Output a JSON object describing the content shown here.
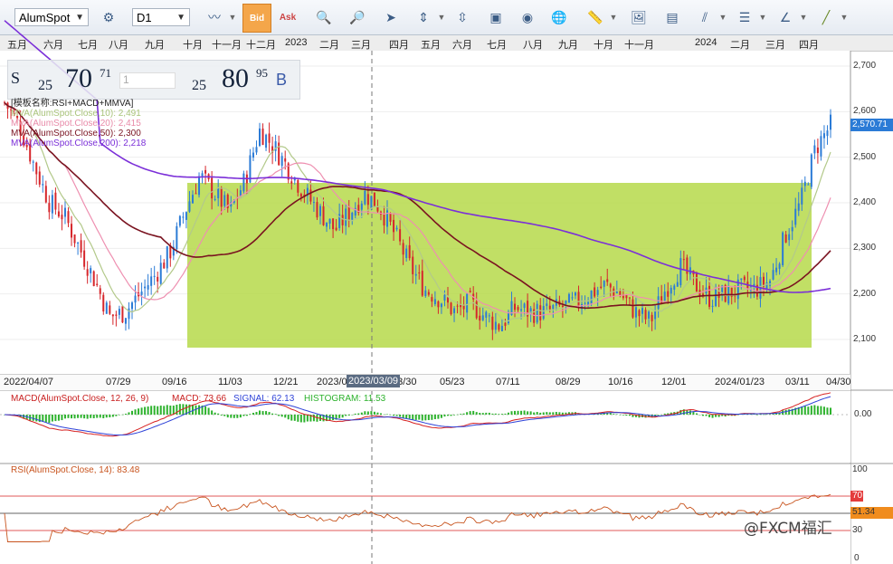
{
  "toolbar": {
    "symbol": "AlumSpot",
    "timeframe": "D1",
    "bid_label": "Bid",
    "ask_label": "Ask"
  },
  "months_top": [
    "五月",
    "六月",
    "七月",
    "八月",
    "九月",
    "十月",
    "十一月",
    "十二月",
    "2023",
    "二月",
    "三月",
    "四月",
    "五月",
    "六月",
    "七月",
    "八月",
    "九月",
    "十月",
    "十一月",
    "2024",
    "二月",
    "三月",
    "四月"
  ],
  "quote": {
    "sell_letter": "S",
    "sell_prefix": "25",
    "sell_big": "70",
    "sell_sup": "71",
    "lot": "1",
    "buy_prefix": "25",
    "buy_big": "80",
    "buy_sup": "95",
    "buy_letter": "B"
  },
  "legend": {
    "template": "[模板名称:RSI+MACD+MMVA]",
    "mva10": "MVA(AlumSpot.Close,10): 2,491",
    "mva20": "MVA(AlumSpot.Close,20): 2,415",
    "mva50": "MVA(AlumSpot.Close,50): 2,300",
    "mva200": "MVA(AlumSpot.Close,200): 2,218"
  },
  "price_axis": {
    "ticks": [
      "2,700",
      "2,600",
      "2,500",
      "2,400",
      "2,300",
      "2,200",
      "2,100"
    ],
    "current": "2,570.71"
  },
  "date_axis": [
    "2022/04/07",
    "07/29",
    "09/16",
    "11/03",
    "12/21",
    "2023/0",
    "03/30",
    "05/23",
    "07/11",
    "08/29",
    "10/16",
    "12/01",
    "2024/01/23",
    "03/11",
    "04/30"
  ],
  "crosshair_date": "2023/03/09",
  "macd": {
    "label": "MACD(AlumSpot.Close, 12, 26, 9)",
    "macd": "MACD: 73.66",
    "signal": "SIGNAL: 62.13",
    "histogram": "HISTOGRAM: 11.53",
    "axis_tick": "0.00"
  },
  "rsi": {
    "label": "RSI(AlumSpot.Close, 14): 83.48",
    "ticks": [
      "100",
      "70",
      "30",
      "0"
    ],
    "current": "51.34"
  },
  "watermark": "@FXCM福汇",
  "colors": {
    "up": "#2b7bd6",
    "down": "#d6262b",
    "box": "#b6d94a",
    "mva10": "#b3c98a",
    "mva20": "#ee8fb0",
    "mva50": "#7a1320",
    "mva200": "#7b2fd8",
    "macd_line": "#d62020",
    "signal_line": "#2f43d8",
    "hist": "#2db22d",
    "rsi_line": "#c8541e"
  },
  "chart_data": {
    "type": "candlestick",
    "close_approx": [
      2620,
      2570,
      2480,
      2400,
      2370,
      2300,
      2230,
      2150,
      2160,
      2200,
      2240,
      2290,
      2380,
      2460,
      2420,
      2380,
      2450,
      2560,
      2520,
      2470,
      2420,
      2380,
      2340,
      2380,
      2420,
      2390,
      2330,
      2260,
      2210,
      2190,
      2160,
      2180,
      2150,
      2130,
      2170,
      2160,
      2160,
      2170,
      2180,
      2200,
      2220,
      2200,
      2160,
      2140,
      2210,
      2260,
      2220,
      2190,
      2200,
      2210,
      2210,
      2230,
      2330,
      2400,
      2520,
      2570
    ],
    "ylim": [
      2050,
      2720
    ]
  }
}
